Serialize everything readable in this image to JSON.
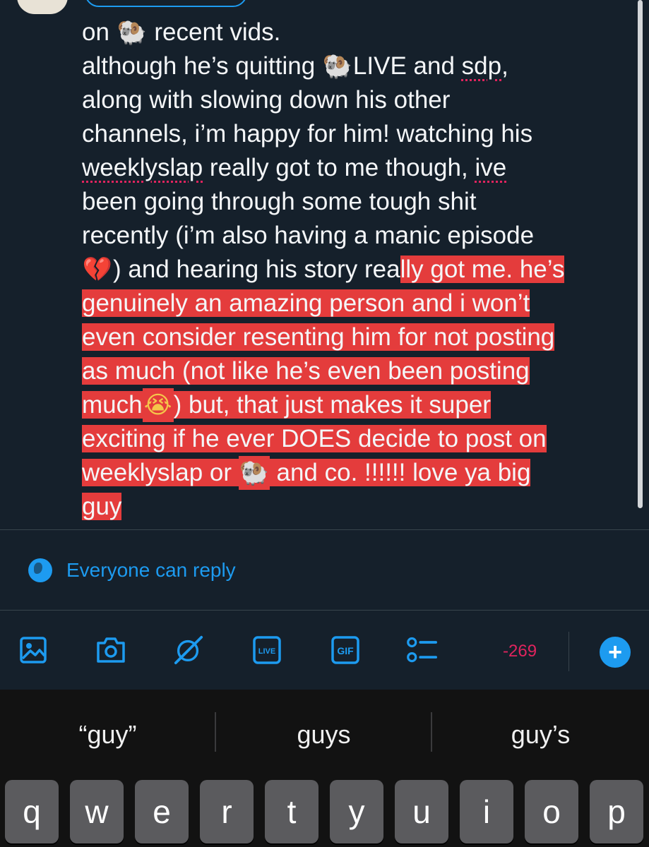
{
  "tweet": {
    "lines": [
      [
        {
          "t": "on "
        },
        {
          "emoji": "ram"
        },
        {
          "t": " recent vids."
        }
      ],
      [
        {
          "t": "although he’s quitting "
        },
        {
          "emoji": "ram"
        },
        {
          "t": "LIVE and "
        },
        {
          "t": "sdp",
          "squiggle": true
        },
        {
          "t": ","
        }
      ],
      [
        {
          "t": "along with slowing down his other"
        }
      ],
      [
        {
          "t": "channels, i’m happy for him! watching his"
        }
      ],
      [
        {
          "t": "weeklyslap",
          "squiggle": true
        },
        {
          "t": " really got to me though, "
        },
        {
          "t": "ive",
          "squiggle": true
        }
      ],
      [
        {
          "t": "been going through some tough shit"
        }
      ],
      [
        {
          "t": "recently (i’m also having a manic episode"
        }
      ],
      [
        {
          "emoji": "heart"
        },
        {
          "t": ") and hearing his story rea"
        },
        {
          "t": "lly got me. he’s",
          "hl": true
        }
      ],
      [
        {
          "t": "genuinely an amazing person and i won’t",
          "hl": true
        }
      ],
      [
        {
          "t": "even consider resenting him for not posting",
          "hl": true
        }
      ],
      [
        {
          "t": "as much (not like he’s even been posting",
          "hl": true
        }
      ],
      [
        {
          "t": "much",
          "hl": true
        },
        {
          "emoji": "cry",
          "hl": true
        },
        {
          "t": ") but, that just makes it super",
          "hl": true
        }
      ],
      [
        {
          "t": "exciting if he ever DOES decide to post on ",
          "hl": true
        }
      ],
      [
        {
          "t": "weeklyslap or ",
          "hl": true
        },
        {
          "emoji": "ram",
          "hl": true
        },
        {
          "t": " and co. !!!!!! love ya big",
          "hl": true
        }
      ],
      [
        {
          "t": "guy",
          "hl": true
        }
      ]
    ]
  },
  "emoji_glyphs": {
    "ram": "🐏",
    "heart": "💔",
    "cry": "😭"
  },
  "reply_setting": {
    "label": "Everyone can reply",
    "icon": "globe-icon"
  },
  "toolbar": {
    "icons": [
      "image-icon",
      "camera-icon",
      "grok-icon",
      "live-icon",
      "gif-icon",
      "poll-icon"
    ],
    "live_label": "LIVE",
    "gif_label": "GIF",
    "char_counter": "-269",
    "add_icon": "+"
  },
  "keyboard": {
    "suggestions": [
      "“guy”",
      "guys",
      "guy’s"
    ],
    "keys": [
      "q",
      "w",
      "e",
      "r",
      "t",
      "y",
      "u",
      "i",
      "o",
      "p"
    ]
  },
  "colors": {
    "background": "#15202b",
    "accent": "#1d9bf0",
    "highlight": "#e43c3c",
    "counter": "#e0245e",
    "keyboard_bg": "#121212",
    "key_bg": "#5b5b5e"
  }
}
